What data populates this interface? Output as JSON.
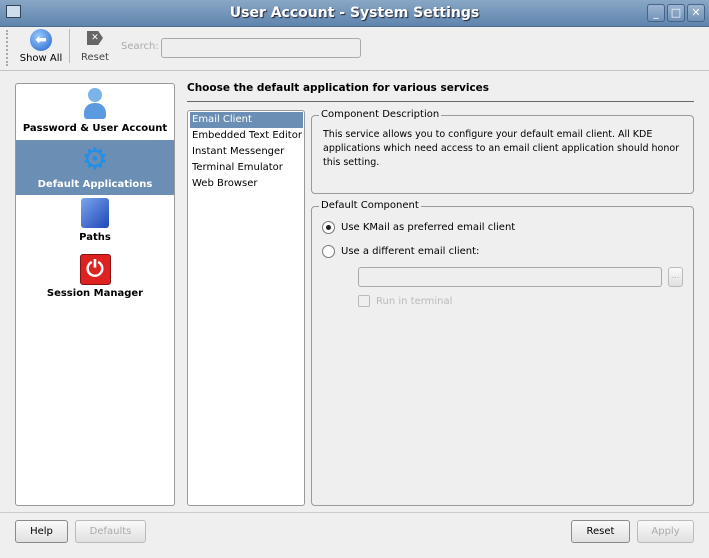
{
  "window": {
    "title": "User Account - System Settings"
  },
  "toolbar": {
    "show_all": "Show All",
    "reset": "Reset",
    "search_label": "Search:",
    "search_value": ""
  },
  "categories": [
    {
      "label": "Password & User Account",
      "selected": false
    },
    {
      "label": "Default Applications",
      "selected": true
    },
    {
      "label": "Paths",
      "selected": false
    },
    {
      "label": "Session Manager",
      "selected": false
    }
  ],
  "heading": "Choose the default application for various services",
  "services": [
    "Email Client",
    "Embedded Text Editor",
    "Instant Messenger",
    "Terminal Emulator",
    "Web Browser"
  ],
  "selected_service": "Email Client",
  "description": {
    "legend": "Component Description",
    "text": "This service allows you to configure your default email client. All KDE applications which need access to an email client application should honor this setting."
  },
  "component": {
    "legend": "Default Component",
    "option1": "Use KMail as preferred email client",
    "option2": "Use a different email client:",
    "client_value": "",
    "browse": "...",
    "run_in_terminal": "Run in terminal"
  },
  "buttons": {
    "help": "Help",
    "defaults": "Defaults",
    "reset": "Reset",
    "apply": "Apply"
  }
}
